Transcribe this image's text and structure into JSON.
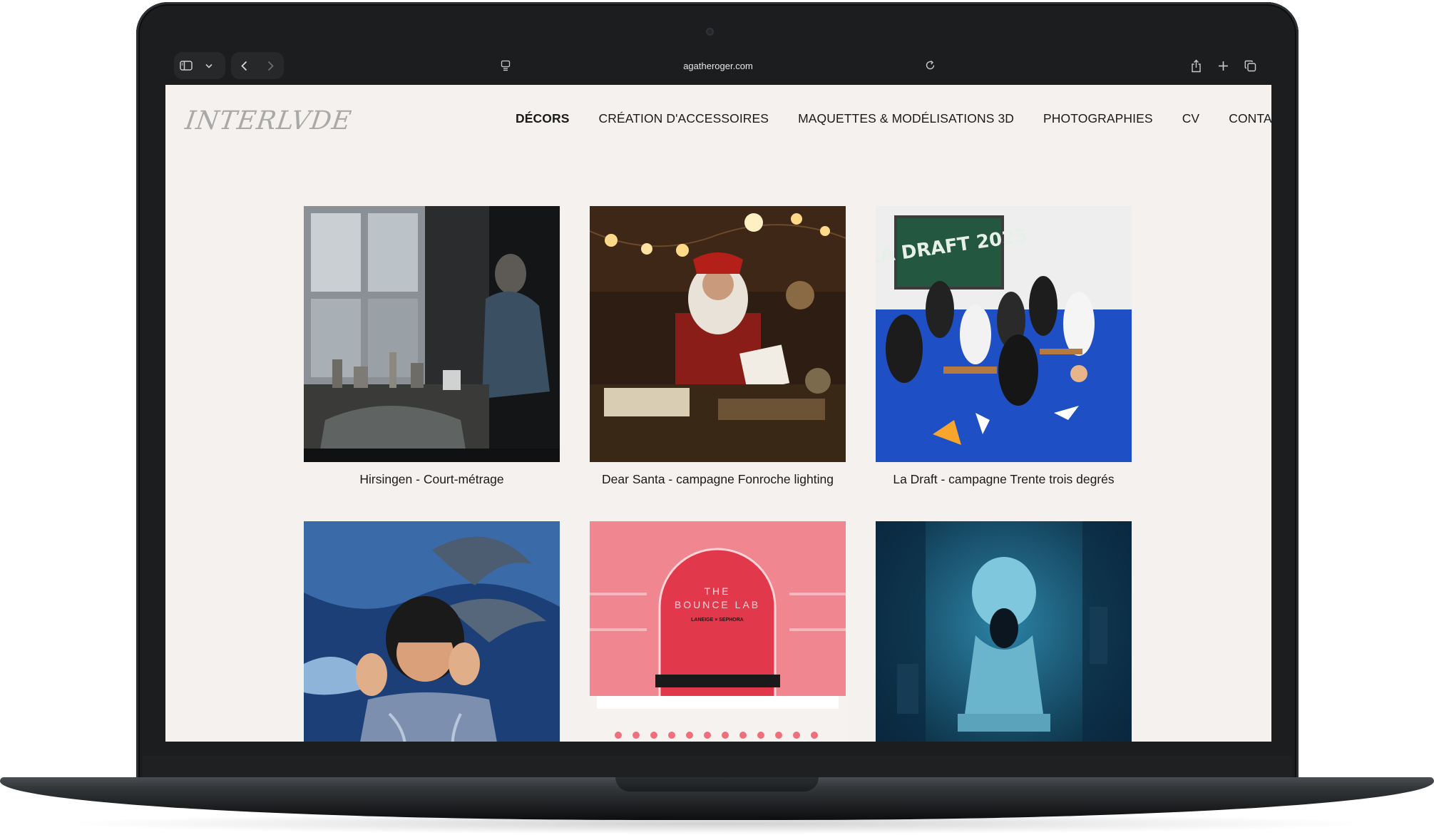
{
  "browser": {
    "url": "agatheroger.com",
    "colors": {
      "frame": "#1b1d1f",
      "toolbar": "#1c1d1f"
    }
  },
  "site": {
    "logo": "INTERLVDE",
    "nav": [
      {
        "label": "DÉCORS",
        "active": true
      },
      {
        "label": "CRÉATION D'ACCESSOIRES",
        "active": false
      },
      {
        "label": "MAQUETTES & MODÉLISATIONS 3D",
        "active": false
      },
      {
        "label": "PHOTOGRAPHIES",
        "active": false
      },
      {
        "label": "CV",
        "active": false
      },
      {
        "label": "CONTACT",
        "active": false
      }
    ],
    "colors": {
      "background": "#f5f1ee",
      "text": "#1a1a1a"
    }
  },
  "gallery": [
    {
      "caption": "Hirsingen - Court-métrage",
      "image": "dark-interior-woman-scene"
    },
    {
      "caption": "Dear Santa - campagne Fonroche lighting",
      "image": "santa-at-desk-scene"
    },
    {
      "caption": "La Draft - campagne Trente trois degrés",
      "image": "classroom-group-blue-floor",
      "sign": "LA DRAFT 2025"
    },
    {
      "caption": "",
      "image": "man-with-dolphins-scene"
    },
    {
      "caption": "",
      "image": "pink-lab-set",
      "sign_line1": "THE",
      "sign_line2": "BOUNCE LAB",
      "sign_line3": "LANEIGE × SEPHORA"
    },
    {
      "caption": "",
      "image": "blue-bust-scene"
    }
  ]
}
